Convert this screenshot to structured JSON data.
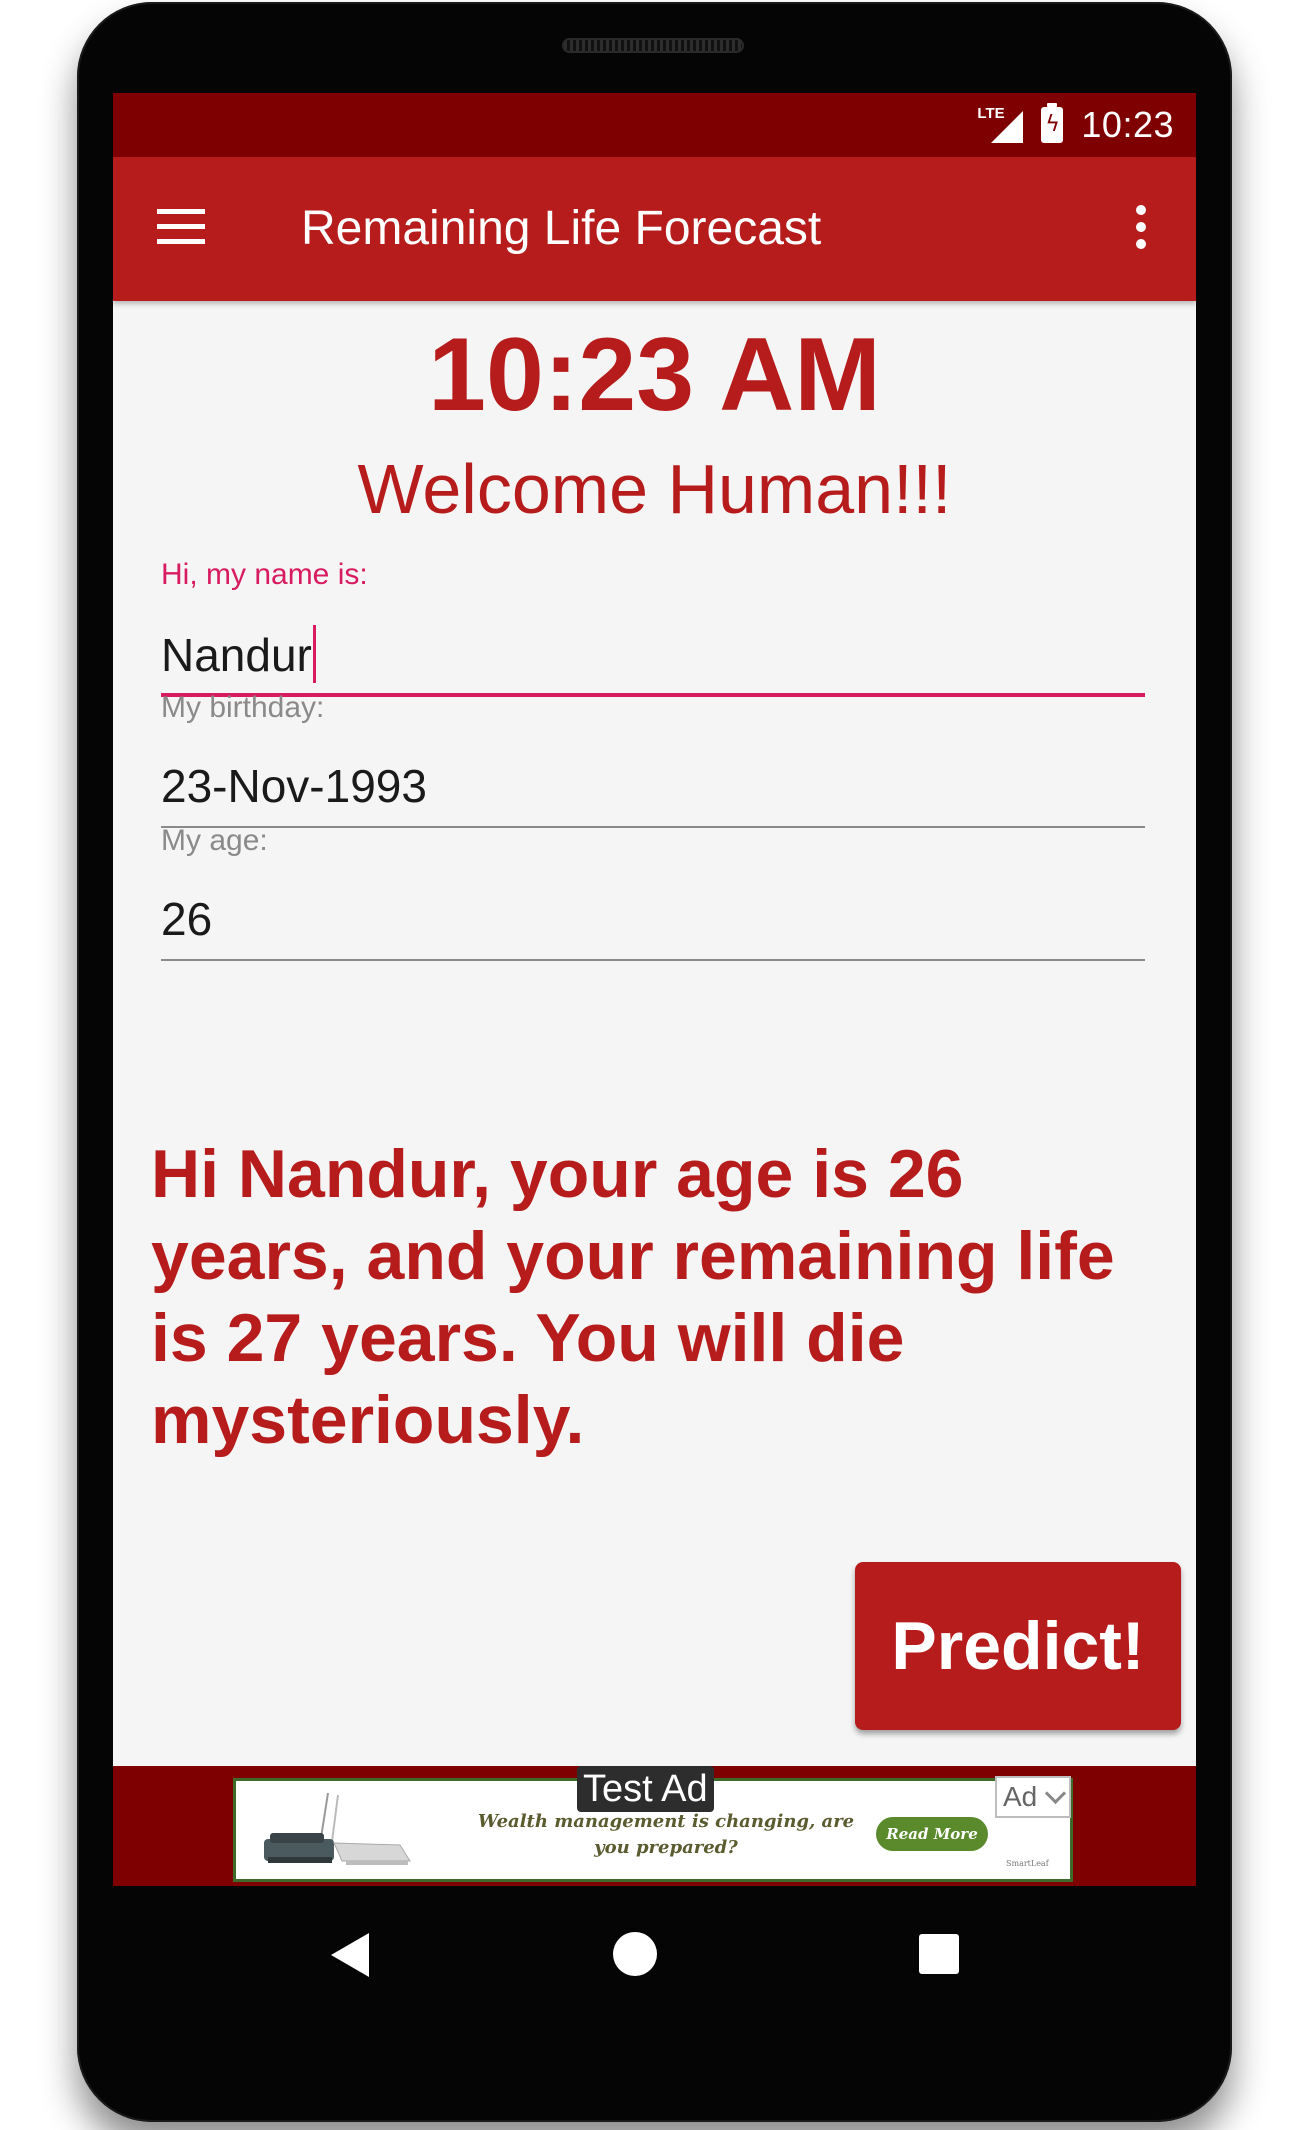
{
  "status_bar": {
    "network": "LTE",
    "time": "10:23"
  },
  "app_bar": {
    "title": "Remaining Life Forecast"
  },
  "main": {
    "clock": "10:23 AM",
    "welcome": "Welcome Human!!!",
    "fields": [
      {
        "label": "Hi, my name is:",
        "value": "Nandur"
      },
      {
        "label": "My birthday:",
        "value": "23-Nov-1993"
      },
      {
        "label": "My age:",
        "value": "26"
      }
    ],
    "result": "Hi Nandur, your age is 26 years, and your remaining life is 27 years. You will die mysteriously.",
    "predict_label": "Predict!"
  },
  "ad": {
    "test_label": "Test Ad",
    "text": "Wealth management is changing, are you prepared?",
    "button": "Read More",
    "badge": "Ad",
    "brand": "SmartLeaf"
  },
  "colors": {
    "primary": "#b71c1c",
    "primary_dark": "#7f0000",
    "accent": "#d81b60",
    "background": "#f5f5f5"
  },
  "icons": {
    "menu": "hamburger-icon",
    "more": "overflow-icon",
    "back": "back-triangle-icon",
    "home": "home-circle-icon",
    "recents": "recents-square-icon"
  }
}
